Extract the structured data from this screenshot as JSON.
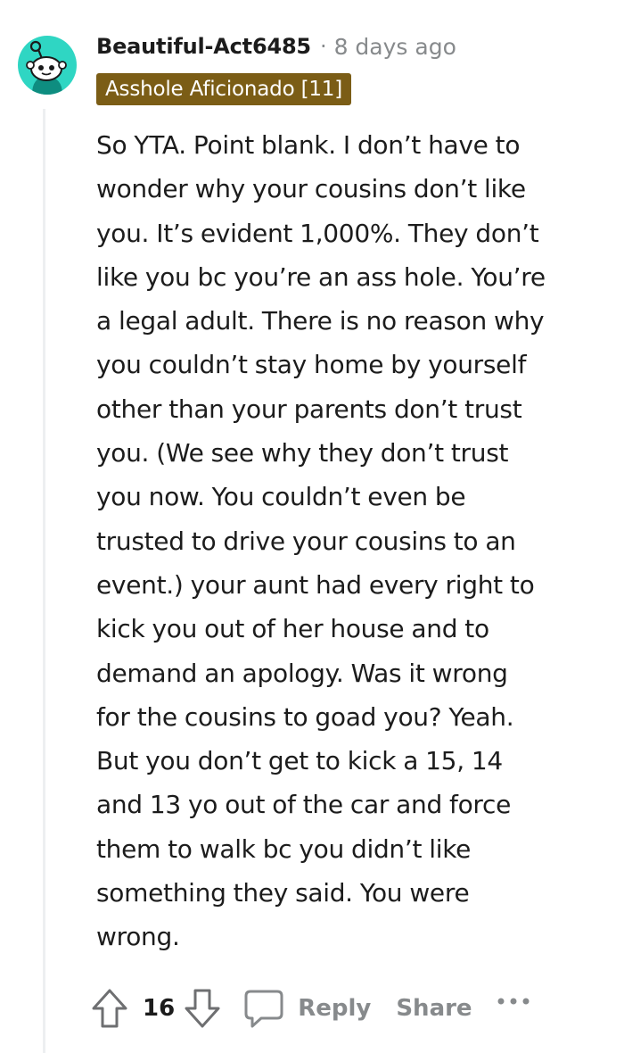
{
  "comment": {
    "author": "Beautiful-Act6485",
    "separator": "·",
    "timestamp": "8 days ago",
    "flair": "Asshole Aficionado [11]",
    "flair_color": "#7b5d16",
    "avatar_color": "#2fd6c3",
    "body_lines": [
      "So YTA. Point blank. I don’t have to",
      "wonder why your cousins don’t like",
      "you. It’s evident 1,000%. They don’t",
      "like you bc you’re an ass hole. You’re",
      "a legal adult. There is no reason why",
      "you couldn’t stay home by yourself",
      "other than your parents don’t trust",
      "you. (We see why they don’t trust",
      "you now. You couldn’t even be",
      "trusted to drive your cousins to an",
      "event.) your aunt had every right to",
      "kick you out of her house and to",
      "demand an apology. Was it wrong",
      "for the cousins to goad you? Yeah.",
      "But you don’t get to kick a 15, 14",
      "and 13 yo out of the car and force",
      "them to walk bc you didn’t like",
      "something they said. You were",
      "wrong."
    ]
  },
  "actions": {
    "upvote_icon": "upvote-arrow-icon",
    "score": "16",
    "downvote_icon": "downvote-arrow-icon",
    "comment_icon": "speech-bubble-icon",
    "reply_label": "Reply",
    "share_label": "Share",
    "more_icon": "ellipsis-icon"
  }
}
